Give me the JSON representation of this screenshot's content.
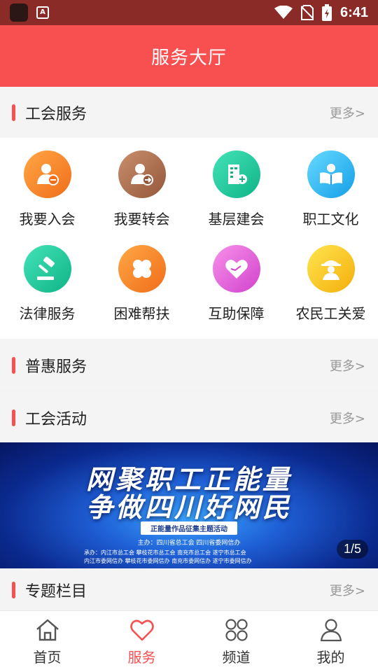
{
  "status_bar": {
    "time": "6:41",
    "app_badge": "A"
  },
  "header": {
    "title": "服务大厅"
  },
  "sections": {
    "union_service": {
      "title": "工会服务",
      "more": "更多>"
    },
    "benefit_service": {
      "title": "普惠服务",
      "more": "更多>"
    },
    "union_activity": {
      "title": "工会活动",
      "more": "更多>"
    },
    "special_topics": {
      "title": "专题栏目",
      "more": "更多>"
    }
  },
  "services": [
    {
      "label": "我要入会",
      "icon": "member-badge-icon",
      "color_from": "#ff9f3a",
      "color_to": "#f2711c"
    },
    {
      "label": "我要转会",
      "icon": "member-transfer-icon",
      "color_from": "#c48b6a",
      "color_to": "#9c5f40"
    },
    {
      "label": "基层建会",
      "icon": "building-add-icon",
      "color_from": "#3fe0b5",
      "color_to": "#11b98a"
    },
    {
      "label": "职工文化",
      "icon": "reader-icon",
      "color_from": "#5fd6ff",
      "color_to": "#1aa8f0"
    },
    {
      "label": "法律服务",
      "icon": "gavel-icon",
      "color_from": "#3fe0b5",
      "color_to": "#11b98a"
    },
    {
      "label": "困难帮扶",
      "icon": "clover-icon",
      "color_from": "#ff9f3a",
      "color_to": "#f2711c"
    },
    {
      "label": "互助保障",
      "icon": "heart-hand-icon",
      "color_from": "#f58ae8",
      "color_to": "#d44ad1"
    },
    {
      "label": "农民工关爱",
      "icon": "worker-icon",
      "color_from": "#ffe04a",
      "color_to": "#f6b40e"
    }
  ],
  "banner": {
    "headline_1": "网聚职工正能量",
    "headline_2": "争做四川好网民",
    "subtitle": "正能量作品征集主题活动",
    "host": "主办：四川省总工会  四川省委网信办",
    "organizers_1": "承办：内江市总工会    攀枝花市总工会    南充市总工会    遂宁市总工会",
    "organizers_2": "内江市委网信办  攀枝花市委网信办  南充市委网信办  遂宁市委网信办",
    "pager": "1/5"
  },
  "tabs": [
    {
      "label": "首页",
      "icon": "home-icon",
      "active": false
    },
    {
      "label": "服务",
      "icon": "heart-icon",
      "active": true
    },
    {
      "label": "频道",
      "icon": "channel-grid-icon",
      "active": false
    },
    {
      "label": "我的",
      "icon": "user-icon",
      "active": false
    }
  ],
  "colors": {
    "accent": "#f84f51",
    "status_bar": "#8a2b28",
    "muted": "#999999"
  }
}
